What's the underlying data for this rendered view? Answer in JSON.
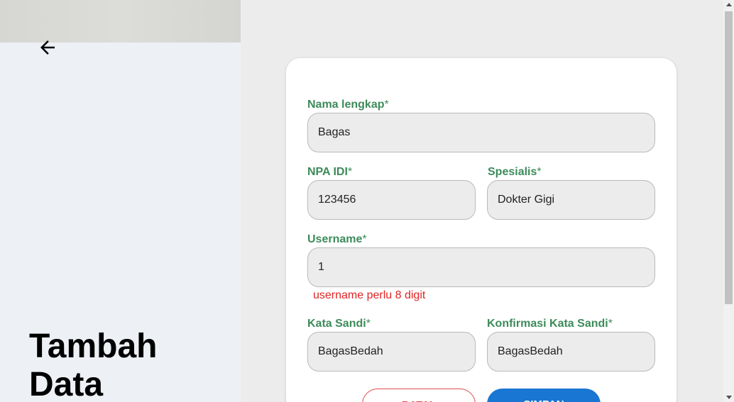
{
  "page": {
    "title_line1": "Tambah",
    "title_line2": "Data"
  },
  "form": {
    "nama_label": "Nama lengkap",
    "nama_value": "Bagas",
    "npa_label": "NPA IDI",
    "npa_value": "123456",
    "spesialis_label": "Spesialis",
    "spesialis_value": "Dokter Gigi",
    "username_label": "Username",
    "username_value": "1",
    "username_error": "username perlu 8 digit",
    "sandi_label": "Kata Sandi",
    "sandi_value": "BagasBedah",
    "konfirmasi_label": "Konfirmasi Kata Sandi",
    "konfirmasi_value": "BagasBedah",
    "required_mark": "*"
  },
  "buttons": {
    "cancel_label": "BATAL",
    "save_label": "SIMPAN"
  },
  "icons": {
    "back": "arrow-left-icon"
  },
  "colors": {
    "label_green": "#3d8b5a",
    "error_red": "#e02424",
    "primary_blue": "#1976d2",
    "cancel_red": "#e04a4a"
  }
}
